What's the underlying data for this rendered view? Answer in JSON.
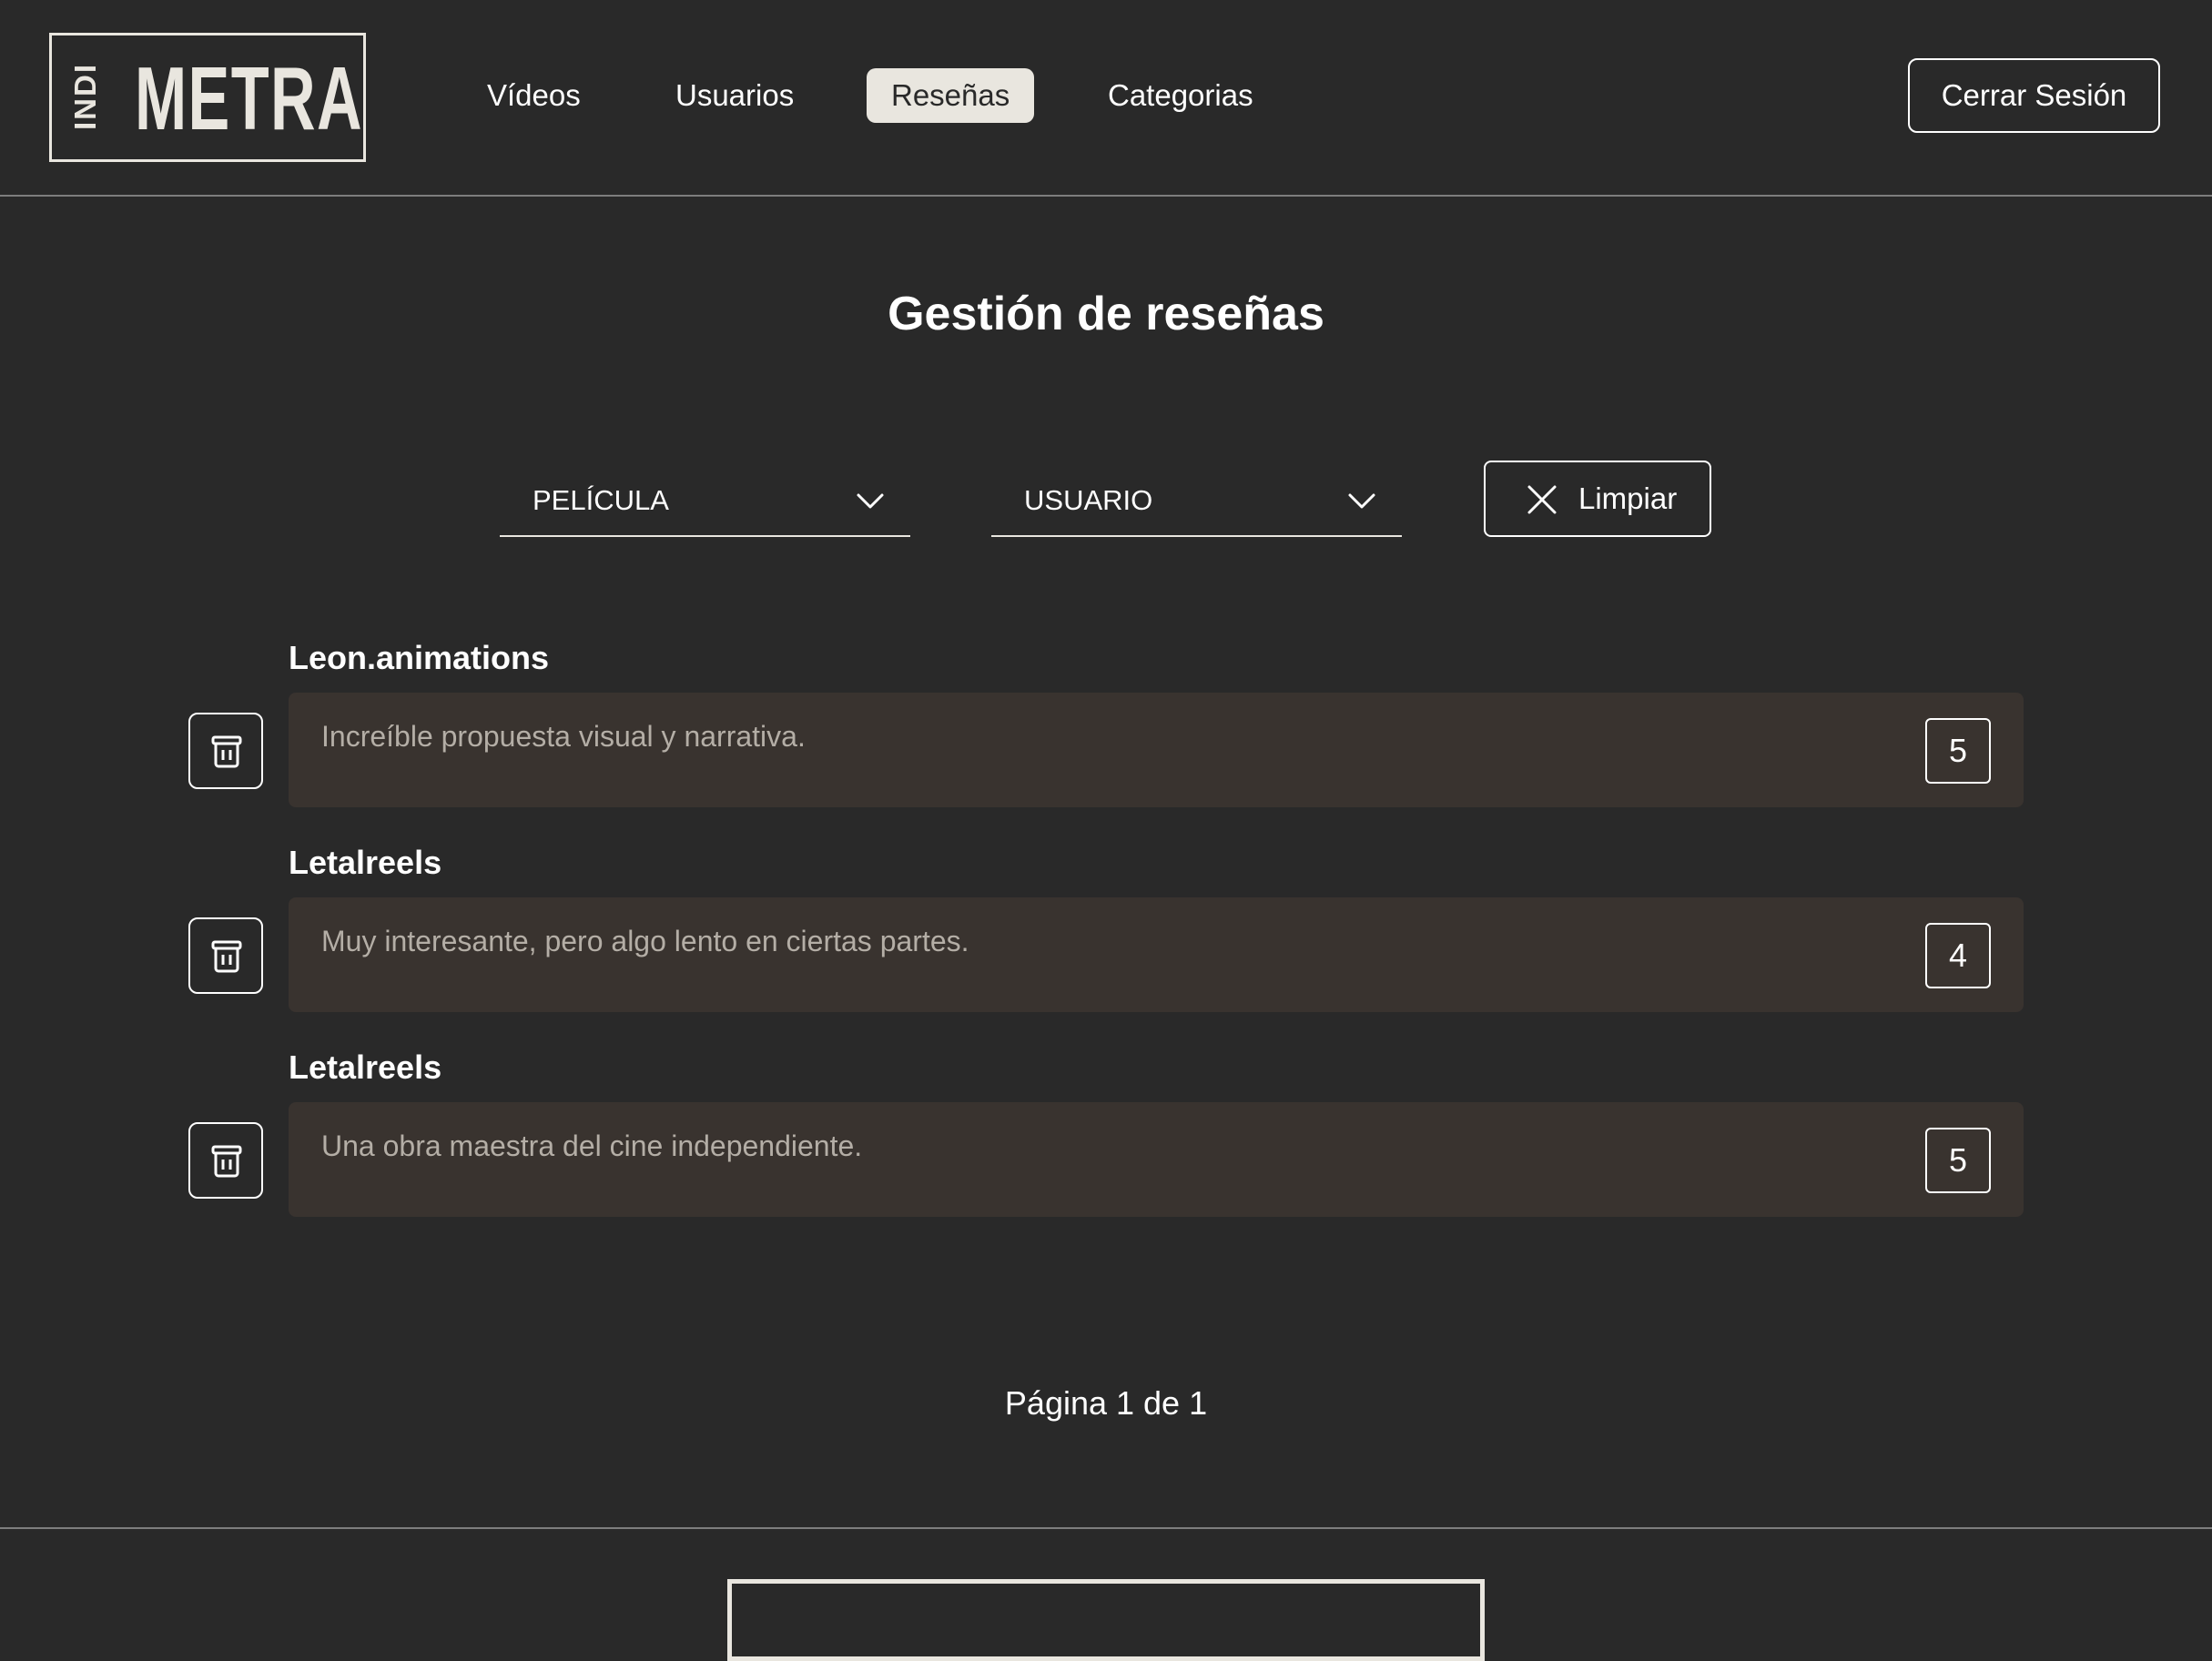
{
  "header": {
    "logo_sub": "INDI",
    "logo_main": "METRA",
    "nav": [
      "Vídeos",
      "Usuarios",
      "Reseñas",
      "Categorias"
    ],
    "active_nav": "Reseñas",
    "logout_label": "Cerrar Sesión"
  },
  "page_title": "Gestión de reseñas",
  "filters": {
    "movie_select": "PELÍCULA",
    "user_select": "USUARIO",
    "clear_label": "Limpiar"
  },
  "reviews": [
    {
      "user": "Leon.animations",
      "text": "Increíble propuesta visual y narrativa.",
      "rating": "5"
    },
    {
      "user": "Letalreels",
      "text": "Muy interesante, pero algo lento en ciertas partes.",
      "rating": "4"
    },
    {
      "user": "Letalreels",
      "text": "Una obra maestra del cine independiente.",
      "rating": "5"
    }
  ],
  "pagination": "Página 1 de 1",
  "colors": {
    "background": "#292929",
    "accent": "#e9e6df",
    "card": "#39332f",
    "muted_text": "#b4aea6"
  }
}
